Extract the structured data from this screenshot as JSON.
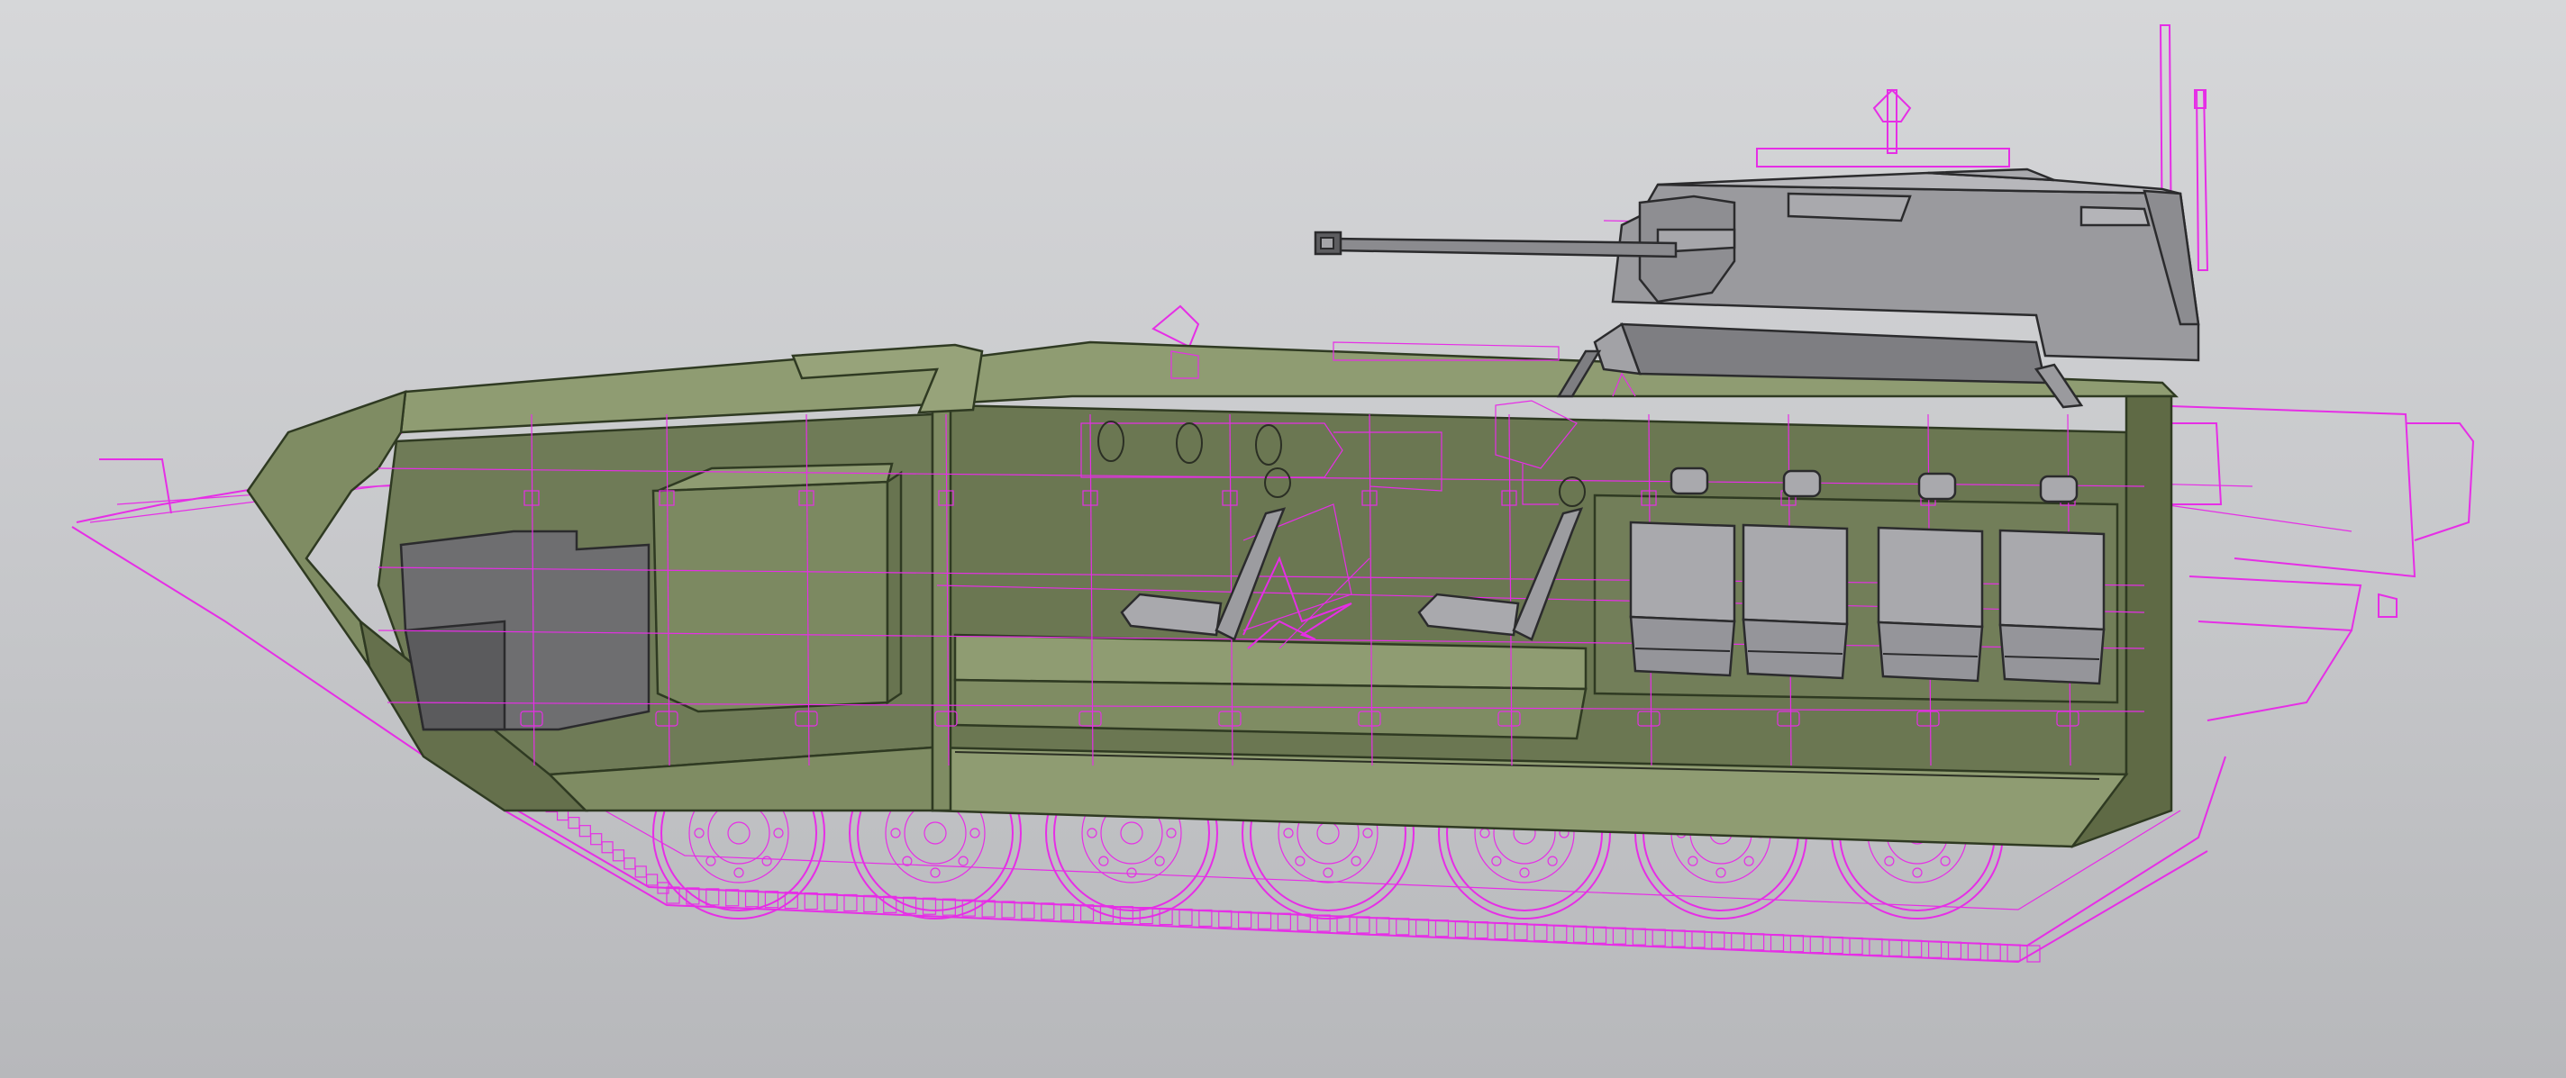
{
  "viewport": {
    "background_top": "#d6d7d9",
    "background_bottom": "#b7b8bb"
  },
  "model": {
    "colors": {
      "hull_light": "#8f9c72",
      "hull_mid": "#7f8c63",
      "hull_dark": "#65704c",
      "interior_grey": "#6e6e70",
      "seat_grey": "#a9a9ad",
      "turret_grey": "#a2a2a6",
      "wireframe": "#e62ee6"
    },
    "road_wheels": 7,
    "crew_seats": 2,
    "troop_seats": 4
  }
}
